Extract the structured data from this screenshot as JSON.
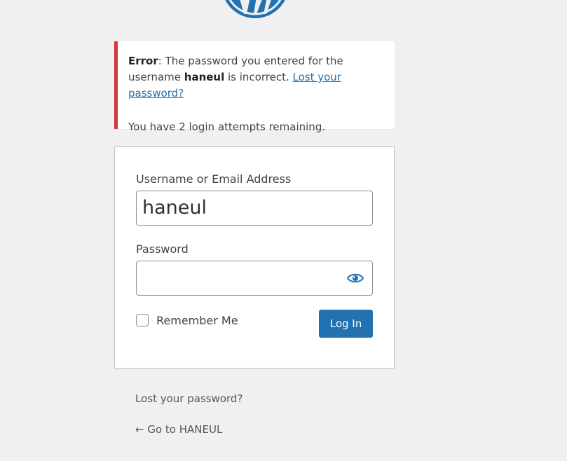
{
  "notice": {
    "error_label": "Error",
    "message_part1": ": The password you entered for the username ",
    "username": "haneul",
    "message_part2": " is incorrect. ",
    "lost_link": "Lost your password?",
    "attempts": "You have 2 login attempts remaining."
  },
  "form": {
    "username_label": "Username or Email Address",
    "username_value": "haneul",
    "password_label": "Password",
    "password_value": "",
    "remember_label": "Remember Me",
    "remember_checked": false,
    "login_button": "Log In"
  },
  "footer": {
    "lost_password": "Lost your password?",
    "back_link": "← Go to HANEUL"
  },
  "colors": {
    "accent": "#2271b1",
    "error": "#d63638",
    "background": "#f0f0f1"
  },
  "icons": {
    "logo": "wordpress-logo-icon",
    "password_toggle": "eye-icon"
  }
}
